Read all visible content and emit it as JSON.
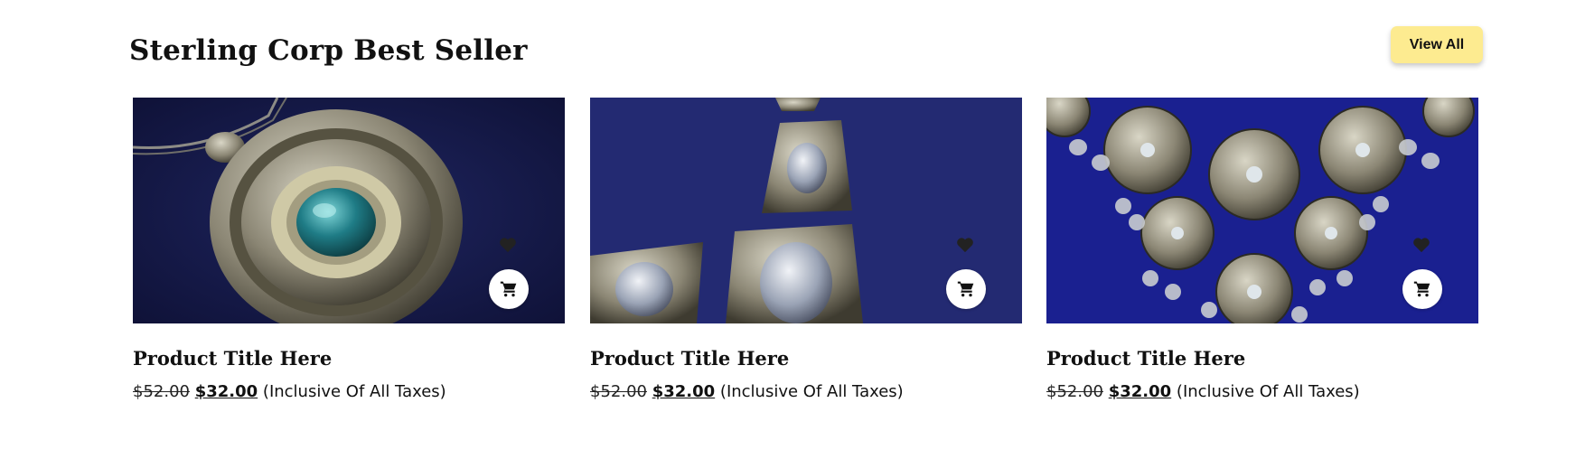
{
  "section": {
    "title": "Sterling Corp Best Seller",
    "view_all_label": "View All"
  },
  "products": [
    {
      "title": "Product Title Here",
      "old_price": "$52.00",
      "new_price": "$32.00",
      "tax_note": "(Inclusive Of All Taxes)",
      "image_subject": "oval pendant with teal stone"
    },
    {
      "title": "Product Title Here",
      "old_price": "$52.00",
      "new_price": "$32.00",
      "tax_note": "(Inclusive Of All Taxes)",
      "image_subject": "trapezoid link necklace with clear stones"
    },
    {
      "title": "Product Title Here",
      "old_price": "$52.00",
      "new_price": "$32.00",
      "tax_note": "(Inclusive Of All Taxes)",
      "image_subject": "medallion necklace with coin fringe"
    }
  ],
  "icons": {
    "wishlist": "heart-icon",
    "cart": "cart-icon"
  },
  "colors": {
    "button_bg": "#fdeb90",
    "image_bg": "#1e2466"
  }
}
